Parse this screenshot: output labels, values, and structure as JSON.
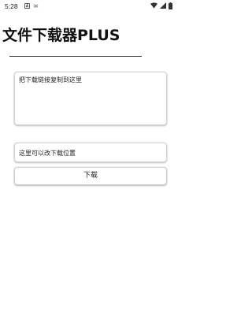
{
  "status_bar": {
    "time": "5:28",
    "icons": [
      "notification-a-icon",
      "usb-icon",
      "wifi-icon",
      "signal-icon",
      "battery-icon"
    ]
  },
  "app": {
    "title": "文件下载器PLUS"
  },
  "url_input": {
    "value": "",
    "placeholder": "把下载链接复制到这里"
  },
  "path_input": {
    "value": "这里可以改下载位置",
    "placeholder": ""
  },
  "download_button": {
    "label": "下载"
  },
  "colors": {
    "background": "#ffffff",
    "text": "#111111",
    "field_border": "#d4d4d4"
  }
}
